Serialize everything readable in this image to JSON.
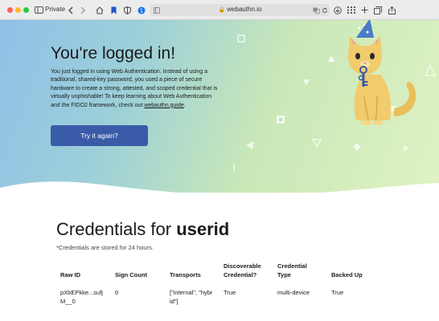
{
  "browser": {
    "private_label": "Private",
    "url": "webauthn.io",
    "icons": [
      "sidebar-icon",
      "back-icon",
      "forward-icon",
      "home-icon",
      "bookmark-icon",
      "shield-icon",
      "extension-icon",
      "tab-icon",
      "translate-icon",
      "reload-icon",
      "download-icon",
      "new-tab-icon",
      "grid-icon",
      "tabs-overview-icon",
      "share-icon"
    ]
  },
  "hero": {
    "title": "You're logged in!",
    "text_1": "You just logged in using Web Authentication. Instead of using a traditional, shared-key password, you used a piece of secure hardware to create a strong, attested, and scoped credential that is virtually unphishable! To keep learning about Web Authentication and the FIDO2 framework, check out ",
    "link": "webauthn.guide",
    "text_2": ".",
    "button": "Try it again?"
  },
  "credentials": {
    "title_prefix": "Credentials for ",
    "username": "userid",
    "note": "*Credentials are stored for 24 hours.",
    "headers": {
      "raw_id": "Raw ID",
      "sign_count": "Sign Count",
      "transports": "Transports",
      "discoverable_1": "Discoverable",
      "discoverable_2": "Credential?",
      "type_1": "Credential",
      "type_2": "Type",
      "backed_up": "Backed Up"
    },
    "row": {
      "raw_id_1": "pXbEPkke...sufj",
      "raw_id_2": "M__0",
      "sign_count": "0",
      "transports_1": "[\"internal\", \"hybr",
      "transports_2": "id\"]",
      "discoverable": "True",
      "type": "multi-device",
      "backed_up": "True"
    }
  }
}
